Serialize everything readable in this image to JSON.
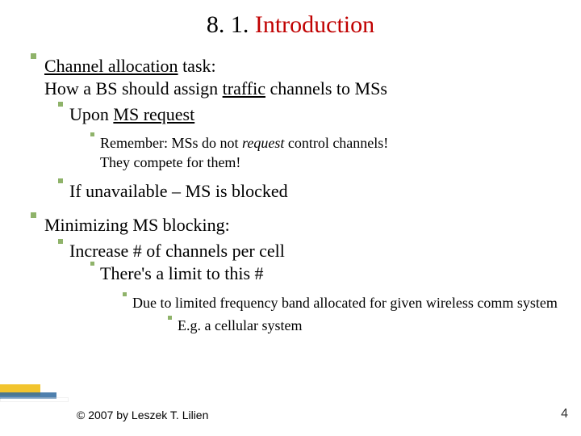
{
  "title_prefix": "8. 1. ",
  "title_main": "Introduction",
  "p1": {
    "line1_a": "Channel allocation",
    "line1_b": " task:",
    "line2_a": "How a BS should assign ",
    "line2_b": "traffic",
    "line2_c": " channels to MSs",
    "sub1_a": "Upon ",
    "sub1_b": "MS request",
    "note_a": "Remember: MSs do not ",
    "note_b": "request",
    "note_c": " control channels!",
    "note_d": "They compete for them!",
    "sub2": "If unavailable – MS is blocked"
  },
  "p2": {
    "line1": "Minimizing MS blocking:",
    "sub1": "Increase # of channels per cell",
    "sub2": "There's a limit to this #",
    "note1": "Due to limited frequency band allocated for given wireless comm system",
    "note2": "E.g. a cellular system"
  },
  "copyright": "© 2007 by Leszek T. Lilien",
  "page": "4"
}
